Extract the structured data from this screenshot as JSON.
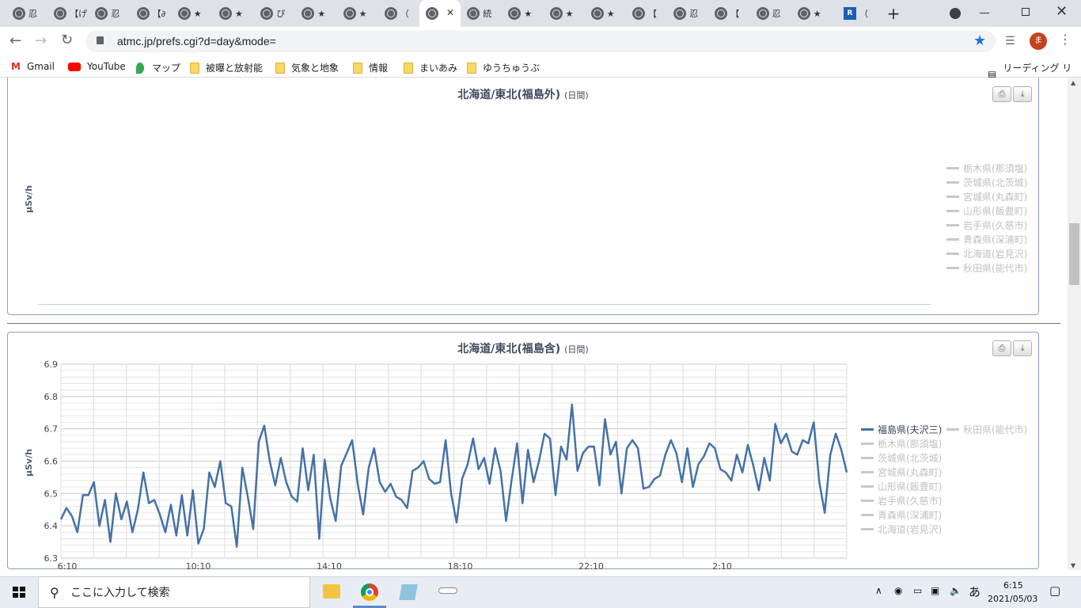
{
  "browser": {
    "tabs": [
      {
        "title": "忍",
        "icon": "globe-icon"
      },
      {
        "title": "【げ",
        "icon": "globe-icon"
      },
      {
        "title": "忍",
        "icon": "globe-icon"
      },
      {
        "title": "【∂",
        "icon": "globe-icon"
      },
      {
        "title": "★",
        "icon": "globe-icon"
      },
      {
        "title": "★",
        "icon": "globe-icon"
      },
      {
        "title": "ぴ",
        "icon": "globe-icon"
      },
      {
        "title": "★",
        "icon": "globe-icon"
      },
      {
        "title": "★",
        "icon": "globe-icon"
      },
      {
        "title": "（",
        "icon": "globe-icon"
      },
      {
        "title": "",
        "icon": "globe-icon",
        "active": true
      },
      {
        "title": "続",
        "icon": "globe-icon"
      },
      {
        "title": "★",
        "icon": "globe-icon"
      },
      {
        "title": "★",
        "icon": "globe-icon"
      },
      {
        "title": "★",
        "icon": "globe-icon"
      },
      {
        "title": "【",
        "icon": "globe-icon"
      },
      {
        "title": "忍",
        "icon": "globe-icon"
      },
      {
        "title": "【",
        "icon": "globe-icon"
      },
      {
        "title": "忍",
        "icon": "globe-icon"
      },
      {
        "title": "★",
        "icon": "globe-icon"
      },
      {
        "title": "（",
        "icon": "rn-icon"
      }
    ],
    "url": "atmc.jp/prefs.cgi?d=day&mode=",
    "profile_initial": "ま",
    "bookmarks": [
      "Gmail",
      "YouTube",
      "マップ",
      "被曝と放射能",
      "気象と地象",
      "情報",
      "まいあみ",
      "ゆうちゅうぶ"
    ],
    "reading_list": "リーディング リスト"
  },
  "chart_top": {
    "title": "北海道/東北(福島外)",
    "subtitle": "(日間)",
    "ylabel": "μSv/h",
    "legend": [
      "栃木県(那須塩)",
      "茨城県(北茨城)",
      "宮城県(丸森町)",
      "山形県(飯豊町)",
      "岩手県(久慈市)",
      "青森県(深浦町)",
      "北海道(岩見沢)",
      "秋田県(能代市)"
    ]
  },
  "chart_data": {
    "type": "line",
    "title": "北海道/東北(福島含)",
    "subtitle": "(日間)",
    "ylabel": "μSv/h",
    "ylim": [
      6.3,
      6.9
    ],
    "yticks": [
      "6.9",
      "6.8",
      "6.7",
      "6.6",
      "6.5",
      "6.4",
      "6.3"
    ],
    "xticks": [
      "6:10",
      "10:10",
      "14:10",
      "18:10",
      "22:10",
      "2:10"
    ],
    "legend_active": "福島県(夫沢三)",
    "legend_inactive": [
      "秋田県(能代市)",
      "栃木県(那須塩)",
      "茨城県(北茨城)",
      "宮城県(丸森町)",
      "山形県(飯豊町)",
      "岩手県(久慈市)",
      "青森県(深浦町)",
      "北海道(岩見沢)"
    ],
    "series": [
      {
        "name": "福島県(夫沢三)",
        "color": "#4572a7",
        "values": [
          6.42,
          6.455,
          6.43,
          6.38,
          6.495,
          6.495,
          6.535,
          6.4,
          6.48,
          6.35,
          6.5,
          6.42,
          6.475,
          6.38,
          6.45,
          6.565,
          6.47,
          6.48,
          6.435,
          6.38,
          6.465,
          6.37,
          6.495,
          6.37,
          6.51,
          6.345,
          6.39,
          6.565,
          6.52,
          6.6,
          6.47,
          6.46,
          6.335,
          6.58,
          6.49,
          6.39,
          6.66,
          6.71,
          6.6,
          6.525,
          6.61,
          6.535,
          6.49,
          6.475,
          6.64,
          6.51,
          6.62,
          6.36,
          6.605,
          6.485,
          6.415,
          6.585,
          6.625,
          6.665,
          6.53,
          6.435,
          6.58,
          6.64,
          6.535,
          6.505,
          6.53,
          6.49,
          6.48,
          6.455,
          6.57,
          6.58,
          6.6,
          6.545,
          6.53,
          6.535,
          6.665,
          6.5,
          6.41,
          6.545,
          6.59,
          6.67,
          6.575,
          6.61,
          6.53,
          6.64,
          6.57,
          6.415,
          6.54,
          6.655,
          6.47,
          6.635,
          6.535,
          6.6,
          6.685,
          6.67,
          6.495,
          6.645,
          6.605,
          6.775,
          6.57,
          6.625,
          6.645,
          6.645,
          6.525,
          6.73,
          6.62,
          6.66,
          6.5,
          6.64,
          6.665,
          6.64,
          6.515,
          6.52,
          6.545,
          6.555,
          6.62,
          6.665,
          6.625,
          6.535,
          6.64,
          6.52,
          6.59,
          6.615,
          6.655,
          6.64,
          6.575,
          6.565,
          6.54,
          6.62,
          6.565,
          6.65,
          6.585,
          6.51,
          6.61,
          6.54,
          6.715,
          6.655,
          6.685,
          6.63,
          6.62,
          6.665,
          6.655,
          6.72,
          6.535,
          6.44,
          6.62,
          6.685,
          6.635,
          6.565
        ]
      }
    ]
  },
  "taskbar": {
    "search_placeholder": "ここに入力して検索",
    "time": "6:15",
    "date": "2021/05/03",
    "ime": "あ"
  }
}
